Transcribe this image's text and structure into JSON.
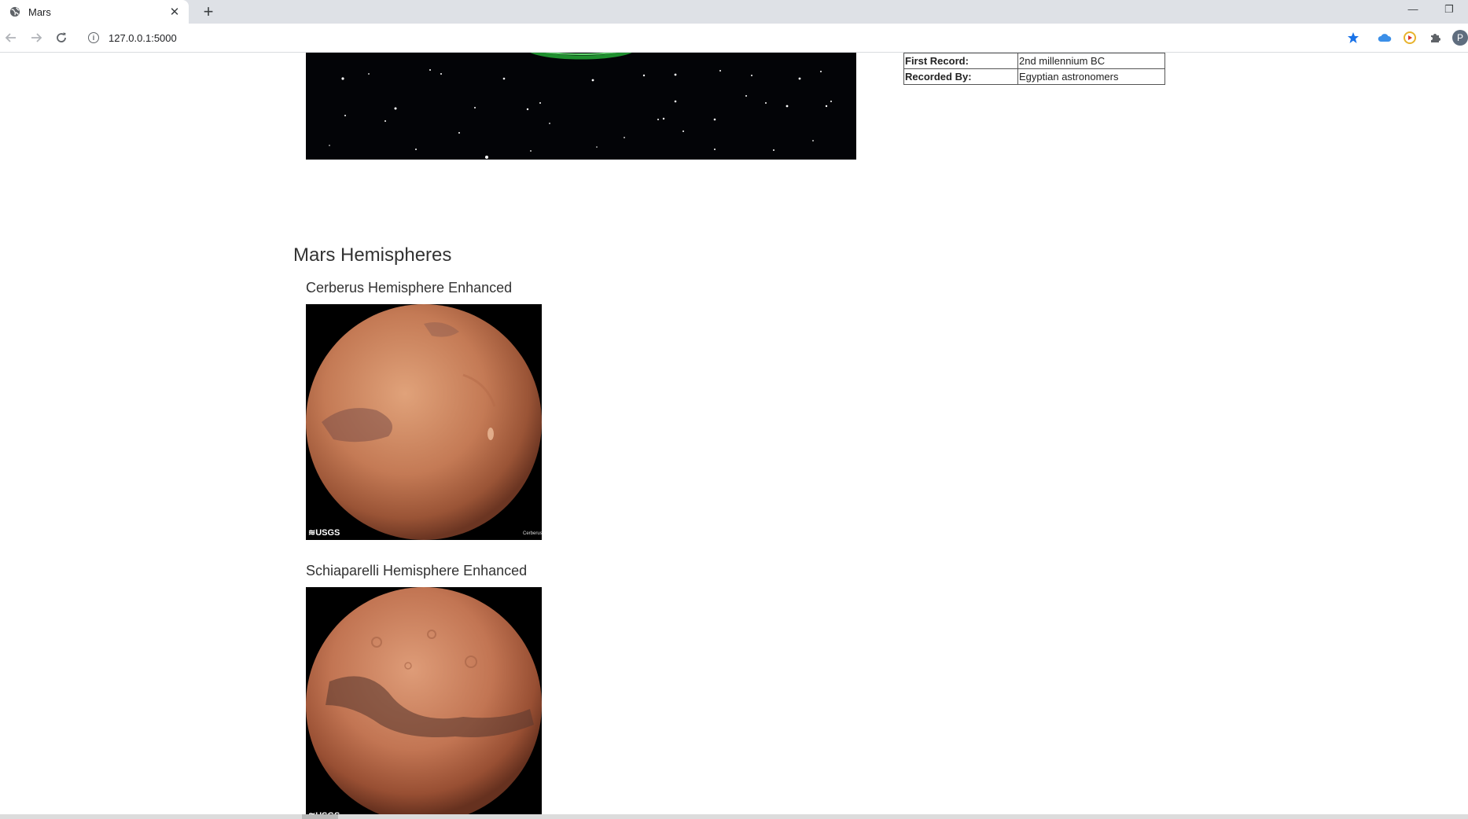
{
  "browser": {
    "tab_title": "Mars",
    "new_tab_label": "+",
    "close_tab_label": "✕",
    "url": "127.0.0.1:5000",
    "profile_initial": "P",
    "window_controls": {
      "minimize": "—",
      "restore": "❐"
    }
  },
  "facts": {
    "rows": [
      {
        "label": "First Record:",
        "value": "2nd millennium BC"
      },
      {
        "label": "Recorded By:",
        "value": "Egyptian astronomers"
      }
    ]
  },
  "hemispheres": {
    "section_title": "Mars Hemispheres",
    "items": [
      {
        "title": "Cerberus Hemisphere Enhanced",
        "logo": "≋USGS",
        "caption": "Cerberus"
      },
      {
        "title": "Schiaparelli Hemisphere Enhanced",
        "logo": "≋USGS",
        "caption": ""
      }
    ]
  },
  "colors": {
    "space_bg": "#030407",
    "mars_light": "#d9946a",
    "mars_dark": "#8a4a32",
    "bookmark_star": "#1a73e8"
  },
  "icons": {
    "favicon": "globe-icon",
    "back": "back-arrow-icon",
    "forward": "forward-arrow-icon",
    "reload": "reload-icon",
    "site_info": "info-icon",
    "bookmark": "star-icon",
    "extensions": [
      "cloud-icon",
      "play-circle-icon",
      "puzzle-icon"
    ]
  }
}
